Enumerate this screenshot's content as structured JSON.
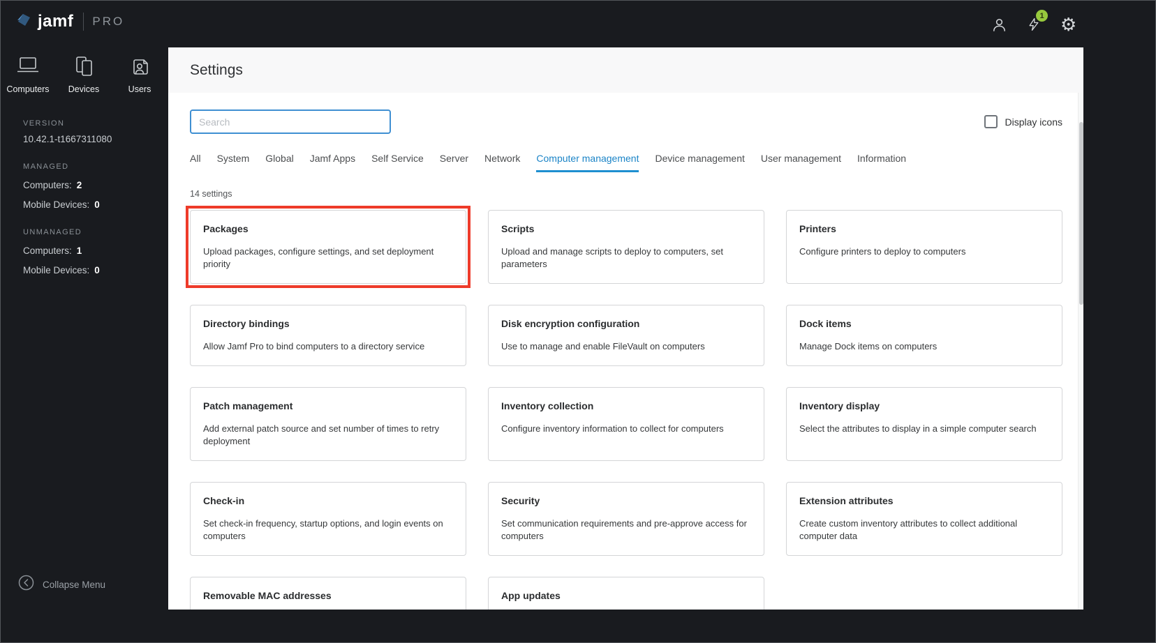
{
  "brand": {
    "name": "jamf",
    "suffix": "PRO"
  },
  "topbar": {
    "notification_count": "1"
  },
  "sidebar": {
    "nav": [
      {
        "label": "Computers"
      },
      {
        "label": "Devices"
      },
      {
        "label": "Users"
      }
    ],
    "version_label": "VERSION",
    "version": "10.42.1-t1667311080",
    "managed_label": "MANAGED",
    "managed": [
      {
        "label": "Computers:",
        "value": "2"
      },
      {
        "label": "Mobile Devices:",
        "value": "0"
      }
    ],
    "unmanaged_label": "UNMANAGED",
    "unmanaged": [
      {
        "label": "Computers:",
        "value": "1"
      },
      {
        "label": "Mobile Devices:",
        "value": "0"
      }
    ],
    "collapse_label": "Collapse Menu"
  },
  "page": {
    "title": "Settings",
    "search_placeholder": "Search",
    "display_icons_label": "Display icons",
    "settings_count": "14 settings"
  },
  "tabs": [
    {
      "label": "All",
      "active": false
    },
    {
      "label": "System",
      "active": false
    },
    {
      "label": "Global",
      "active": false
    },
    {
      "label": "Jamf Apps",
      "active": false
    },
    {
      "label": "Self Service",
      "active": false
    },
    {
      "label": "Server",
      "active": false
    },
    {
      "label": "Network",
      "active": false
    },
    {
      "label": "Computer management",
      "active": true
    },
    {
      "label": "Device management",
      "active": false
    },
    {
      "label": "User management",
      "active": false
    },
    {
      "label": "Information",
      "active": false
    }
  ],
  "cards": [
    {
      "title": "Packages",
      "description": "Upload packages, configure settings, and set deployment priority",
      "highlighted": true
    },
    {
      "title": "Scripts",
      "description": "Upload and manage scripts to deploy to computers, set parameters",
      "highlighted": false
    },
    {
      "title": "Printers",
      "description": "Configure printers to deploy to computers",
      "highlighted": false
    },
    {
      "title": "Directory bindings",
      "description": "Allow Jamf Pro to bind computers to a directory service",
      "highlighted": false
    },
    {
      "title": "Disk encryption configuration",
      "description": "Use to manage and enable FileVault on computers",
      "highlighted": false
    },
    {
      "title": "Dock items",
      "description": "Manage Dock items on computers",
      "highlighted": false
    },
    {
      "title": "Patch management",
      "description": "Add external patch source and set number of times to retry deployment",
      "highlighted": false
    },
    {
      "title": "Inventory collection",
      "description": "Configure inventory information to collect for computers",
      "highlighted": false
    },
    {
      "title": "Inventory display",
      "description": "Select the attributes to display in a simple computer search",
      "highlighted": false
    },
    {
      "title": "Check-in",
      "description": "Set check-in frequency, startup options, and login events on computers",
      "highlighted": false
    },
    {
      "title": "Security",
      "description": "Set communication requirements and pre-approve access for computers",
      "highlighted": false
    },
    {
      "title": "Extension attributes",
      "description": "Create custom inventory attributes to collect additional computer data",
      "highlighted": false
    },
    {
      "title": "Removable MAC addresses",
      "description": "",
      "highlighted": false
    },
    {
      "title": "App updates",
      "description": "",
      "highlighted": false
    }
  ],
  "colors": {
    "accent_blue": "#1b84c7",
    "search_border_blue": "#3f8fd2",
    "highlight_red": "#ee3b2a",
    "badge_green": "#97c93d",
    "dark_bg": "#191b1f"
  }
}
